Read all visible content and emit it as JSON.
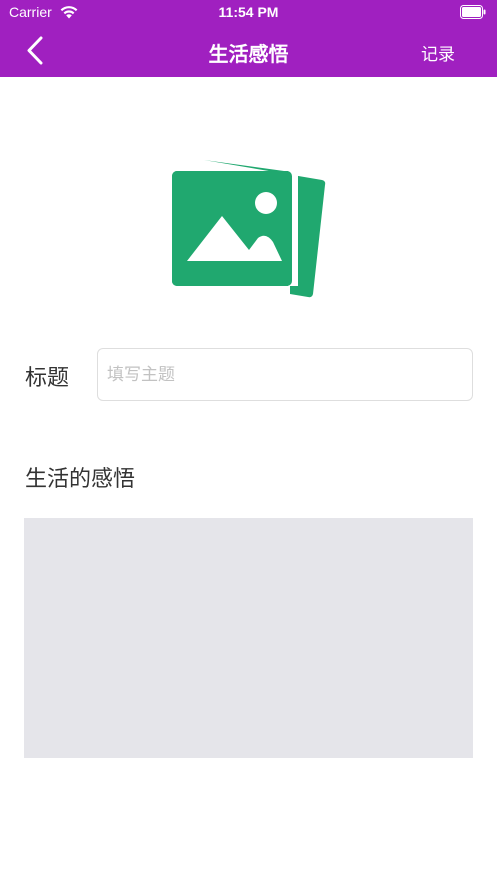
{
  "status_bar": {
    "carrier": "Carrier",
    "time": "11:54 PM",
    "icons": [
      "wifi-icon",
      "battery-icon"
    ]
  },
  "nav": {
    "back_icon": "chevron-left-icon",
    "title": "生活感悟",
    "right_label": "记录"
  },
  "photo": {
    "icon": "photo-gallery-icon",
    "color": "#20a86f"
  },
  "form": {
    "title_label": "标题",
    "title_value": "",
    "title_placeholder": "填写主题",
    "content_label": "生活的感悟",
    "content_value": ""
  },
  "colors": {
    "accent": "#a020c0",
    "icon_green": "#20a86f",
    "content_bg": "#e5e5ea"
  }
}
